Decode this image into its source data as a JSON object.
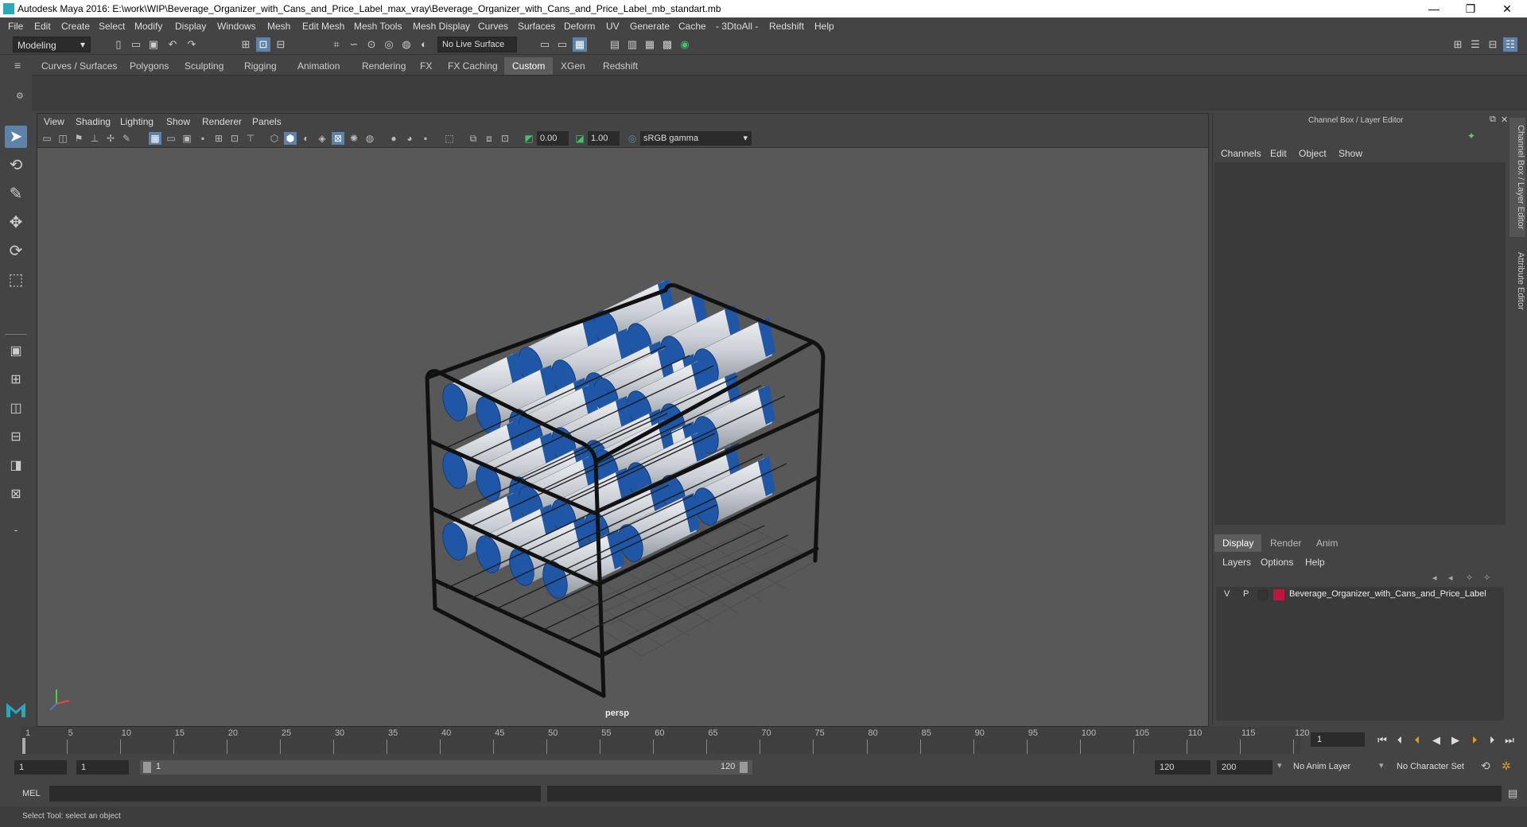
{
  "window": {
    "title": "Autodesk Maya 2016: E:\\work\\WIP\\Beverage_Organizer_with_Cans_and_Price_Label_max_vray\\Beverage_Organizer_with_Cans_and_Price_Label_mb_standart.mb",
    "minimize": "—",
    "restore": "❐",
    "close": "✕"
  },
  "menus": [
    "File",
    "Edit",
    "Create",
    "Select",
    "Modify",
    "Display",
    "Windows",
    "Mesh",
    "Edit Mesh",
    "Mesh Tools",
    "Mesh Display",
    "Curves",
    "Surfaces",
    "Deform",
    "UV",
    "Generate",
    "Cache",
    "- 3DtoAll -",
    "Redshift",
    "Help"
  ],
  "statusline": {
    "mode": "Modeling",
    "live_surface": "No Live Surface"
  },
  "shelf_tabs": [
    "Curves / Surfaces",
    "Polygons",
    "Sculpting",
    "Rigging",
    "Animation",
    "Rendering",
    "FX",
    "FX Caching",
    "Custom",
    "XGen",
    "Redshift"
  ],
  "active_shelf": "Custom",
  "viewport": {
    "menus": [
      "View",
      "Shading",
      "Lighting",
      "Show",
      "Renderer",
      "Panels"
    ],
    "exposure": "0.00",
    "gamma": "1.00",
    "color_space": "sRGB gamma",
    "camera": "persp"
  },
  "channel_box": {
    "title": "Channel Box / Layer Editor",
    "menus": [
      "Channels",
      "Edit",
      "Object",
      "Show"
    ],
    "side_tabs": [
      "Channel Box / Layer Editor",
      "Attribute Editor"
    ],
    "layer_tabs": [
      "Display",
      "Render",
      "Anim"
    ],
    "layer_menus": [
      "Layers",
      "Options",
      "Help"
    ],
    "layer": {
      "v": "V",
      "p": "P",
      "name": "Beverage_Organizer_with_Cans_and_Price_Label",
      "color": "#c0143c"
    }
  },
  "timeline": {
    "ticks": [
      "1",
      "5",
      "10",
      "15",
      "20",
      "25",
      "30",
      "35",
      "40",
      "45",
      "50",
      "55",
      "60",
      "65",
      "70",
      "75",
      "80",
      "85",
      "90",
      "95",
      "100",
      "105",
      "110",
      "115",
      "120"
    ],
    "current_frame": "1"
  },
  "range": {
    "start": "1",
    "playback_start": "1",
    "slider_start": "1",
    "slider_end": "120",
    "playback_end": "120",
    "end": "200",
    "anim_layer": "No Anim Layer",
    "character_set": "No Character Set"
  },
  "command_line": {
    "label": "MEL"
  },
  "help_line": "Select Tool: select an object",
  "colors": {
    "accent": "#5d84a8",
    "maya_logo": "#2aa7b9",
    "can_blue": "#1f57a6"
  }
}
